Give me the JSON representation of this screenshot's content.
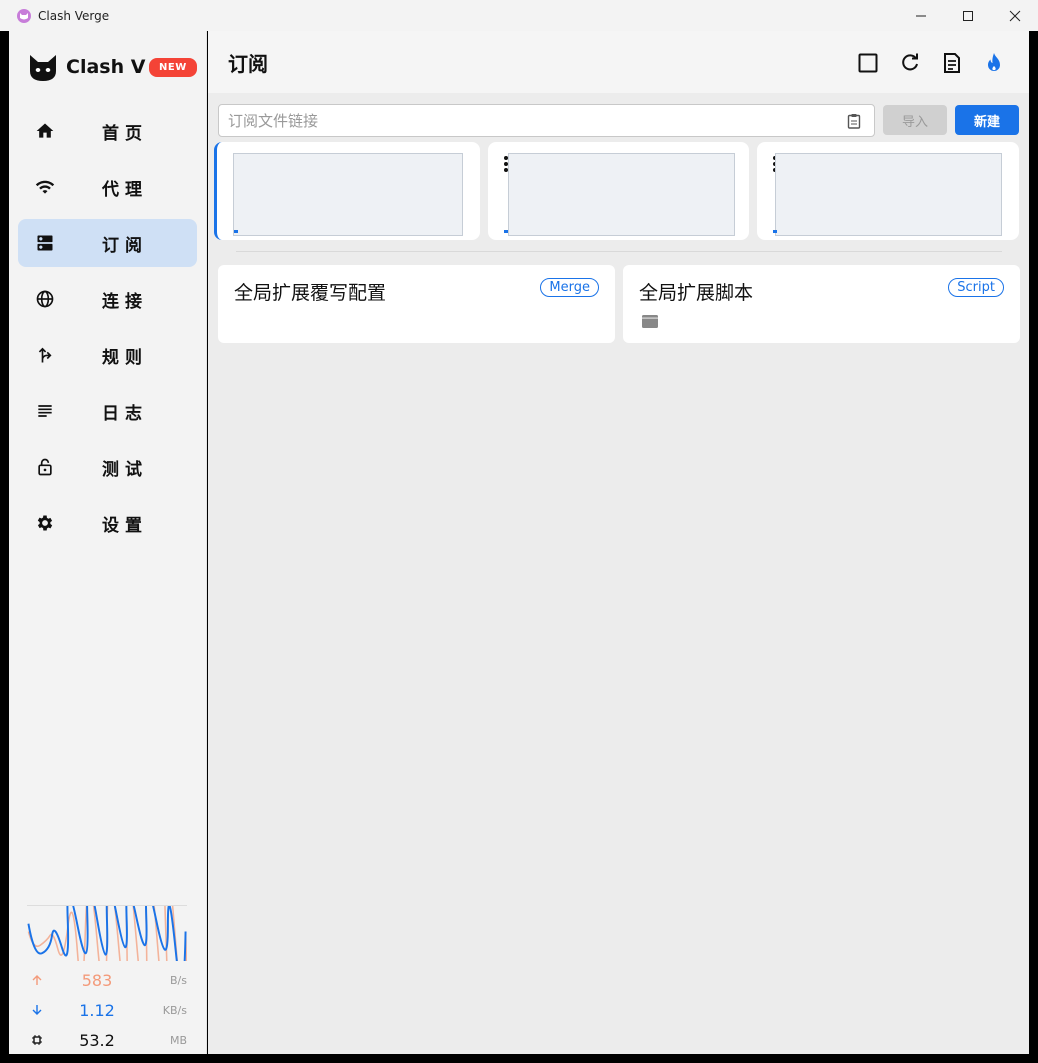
{
  "window": {
    "title": "Clash Verge"
  },
  "sidebar": {
    "logo_text": "Clash V",
    "new_badge": "NEW",
    "items": [
      {
        "label": "首页",
        "icon": "home-icon"
      },
      {
        "label": "代理",
        "icon": "wifi-icon"
      },
      {
        "label": "订阅",
        "icon": "dns-icon",
        "active": true
      },
      {
        "label": "连接",
        "icon": "globe-icon"
      },
      {
        "label": "规则",
        "icon": "fork-right-icon"
      },
      {
        "label": "日志",
        "icon": "subject-icon"
      },
      {
        "label": "测试",
        "icon": "lock-open-icon"
      },
      {
        "label": "设置",
        "icon": "gear-icon"
      }
    ],
    "traffic": {
      "upload_value": "583",
      "upload_unit": "B/s",
      "download_value": "1.12",
      "download_unit": "KB/s",
      "memory_value": "53.2",
      "memory_unit": "MB",
      "upload_color": "#f39a7a",
      "download_color": "#1a73e8"
    }
  },
  "main": {
    "title": "订阅",
    "header_icons": [
      "select-all-icon",
      "refresh-icon",
      "article-icon",
      "fire-icon"
    ],
    "url_placeholder": "订阅文件链接",
    "import_label": "导入",
    "new_label": "新建",
    "extensions": [
      {
        "title": "全局扩展覆写配置",
        "tag": "Merge"
      },
      {
        "title": "全局扩展脚本",
        "tag": "Script"
      }
    ]
  },
  "colors": {
    "accent": "#1a73e8",
    "badge": "#f44336",
    "active_nav": "#cfe0f5"
  }
}
